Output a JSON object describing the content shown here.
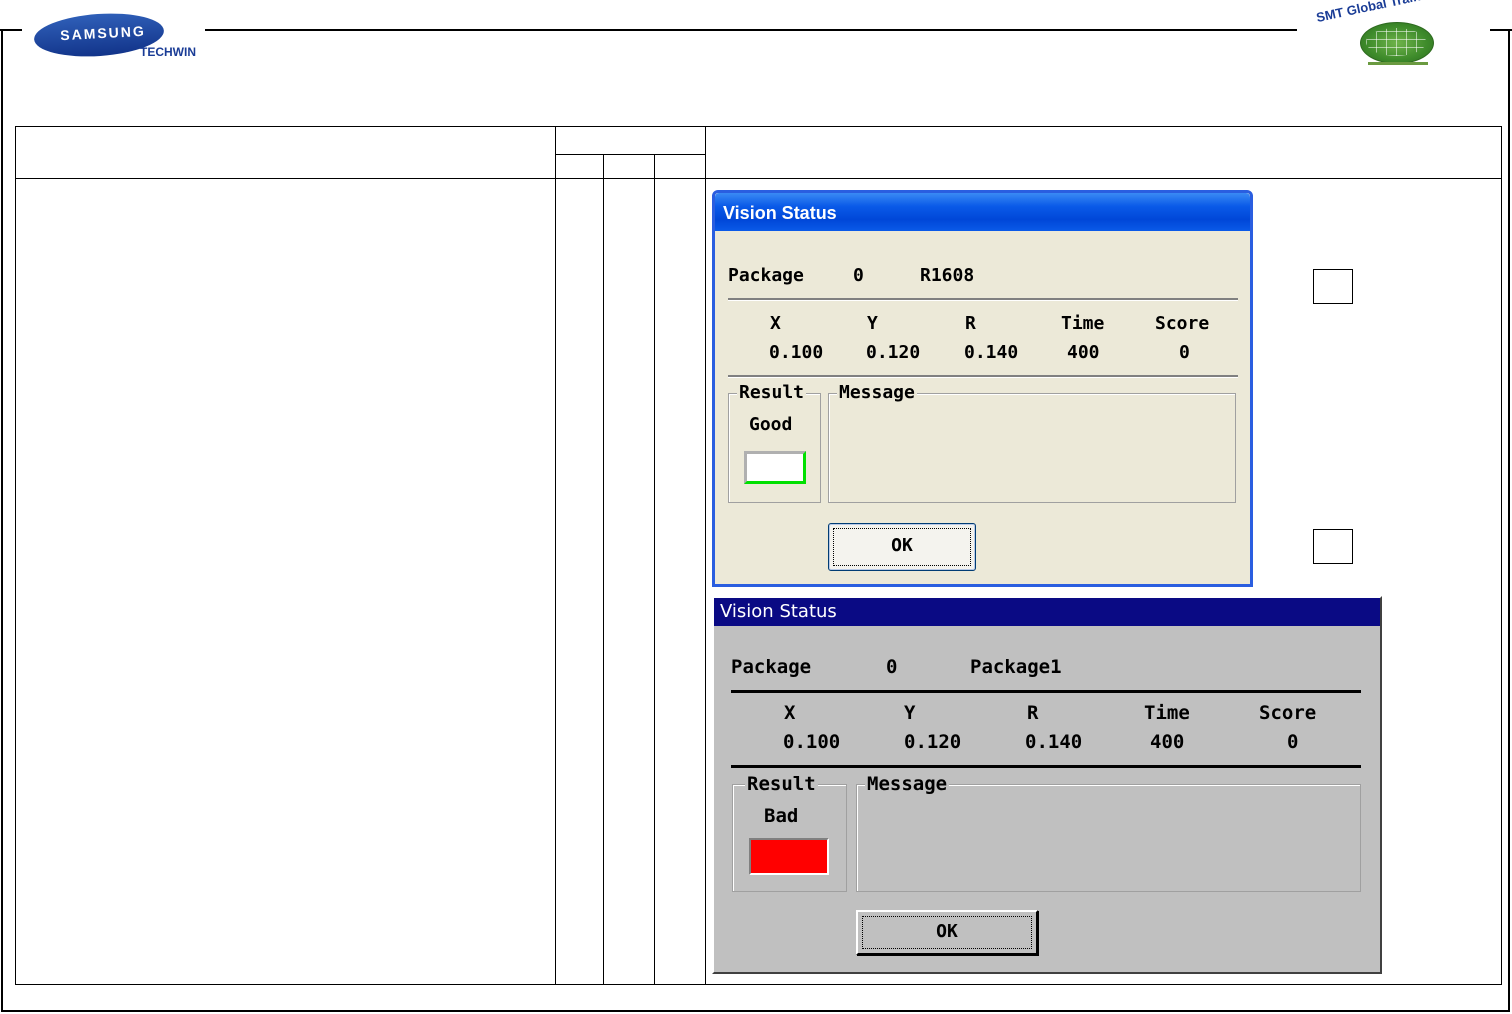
{
  "header": {
    "samsung_logo_text": "SAMSUNG",
    "techwin_text": "TECHWIN",
    "training_logo_text": "SMT Global Training Center"
  },
  "dialogs": {
    "good": {
      "title": "Vision Status",
      "package_label": "Package",
      "package_number": "0",
      "package_name": "R1608",
      "headers": [
        "X",
        "Y",
        "R",
        "Time",
        "Score"
      ],
      "values": [
        "0.100",
        "0.120",
        "0.140",
        "400",
        "0"
      ],
      "result_label": "Result",
      "result_value": "Good",
      "result_color": "#00e000",
      "message_label": "Message",
      "message_text": "",
      "ok_label": "OK"
    },
    "bad": {
      "title": "Vision Status",
      "package_label": "Package",
      "package_number": "0",
      "package_name": "Package1",
      "headers": [
        "X",
        "Y",
        "R",
        "Time",
        "Score"
      ],
      "values": [
        "0.100",
        "0.120",
        "0.140",
        "400",
        "0"
      ],
      "result_label": "Result",
      "result_value": "Bad",
      "result_color": "#ff0000",
      "message_label": "Message",
      "message_text": "",
      "ok_label": "OK"
    }
  }
}
